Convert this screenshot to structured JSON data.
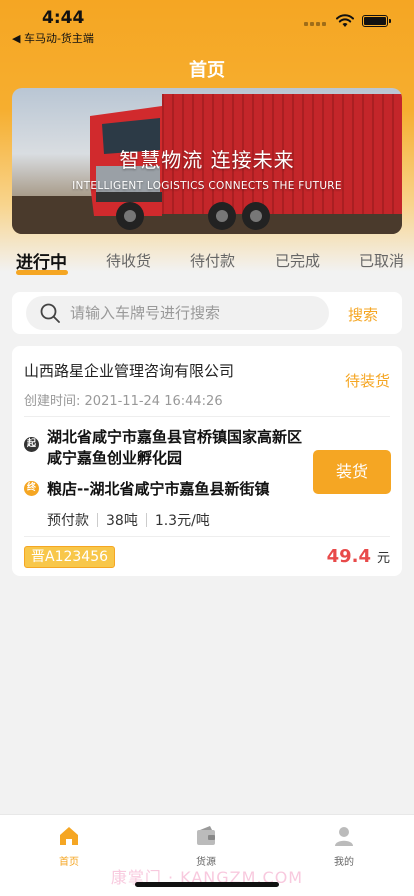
{
  "status_bar": {
    "time": "4:44",
    "back_app": "◀ 车马动-货主端"
  },
  "header": {
    "title": "首页"
  },
  "banner": {
    "title": "智慧物流 连接未来",
    "subtitle": "INTELLIGENT LOGISTICS CONNECTS THE FUTURE"
  },
  "tabs": [
    {
      "label": "进行中",
      "active": true
    },
    {
      "label": "待收货",
      "active": false
    },
    {
      "label": "待付款",
      "active": false
    },
    {
      "label": "已完成",
      "active": false
    },
    {
      "label": "已取消",
      "active": false
    }
  ],
  "search": {
    "placeholder": "请输入车牌号进行搜索",
    "button_label": "搜索"
  },
  "order": {
    "company": "山西路星企业管理咨询有限公司",
    "status": "待装货",
    "created_label": "创建时间:",
    "created_time": "2021-11-24 16:44:26",
    "origin_badge": "起",
    "origin": "湖北省咸宁市嘉鱼县官桥镇国家高新区咸宁嘉鱼创业孵化园",
    "dest_badge": "终",
    "destination": "粮店--湖北省咸宁市嘉鱼县新街镇",
    "payment": "预付款",
    "weight": "38吨",
    "rate": "1.3元/吨",
    "plate": "晋A123456",
    "price": "49.4",
    "price_unit": "元",
    "load_button": "装货"
  },
  "tabbar": [
    {
      "label": "首页",
      "icon": "home-icon",
      "active": true
    },
    {
      "label": "货源",
      "icon": "wallet-icon",
      "active": false
    },
    {
      "label": "我的",
      "icon": "user-icon",
      "active": false
    }
  ],
  "watermark": "康掌门 · KANGZM.COM",
  "colors": {
    "accent": "#f5a623",
    "price": "#e84a4a"
  }
}
